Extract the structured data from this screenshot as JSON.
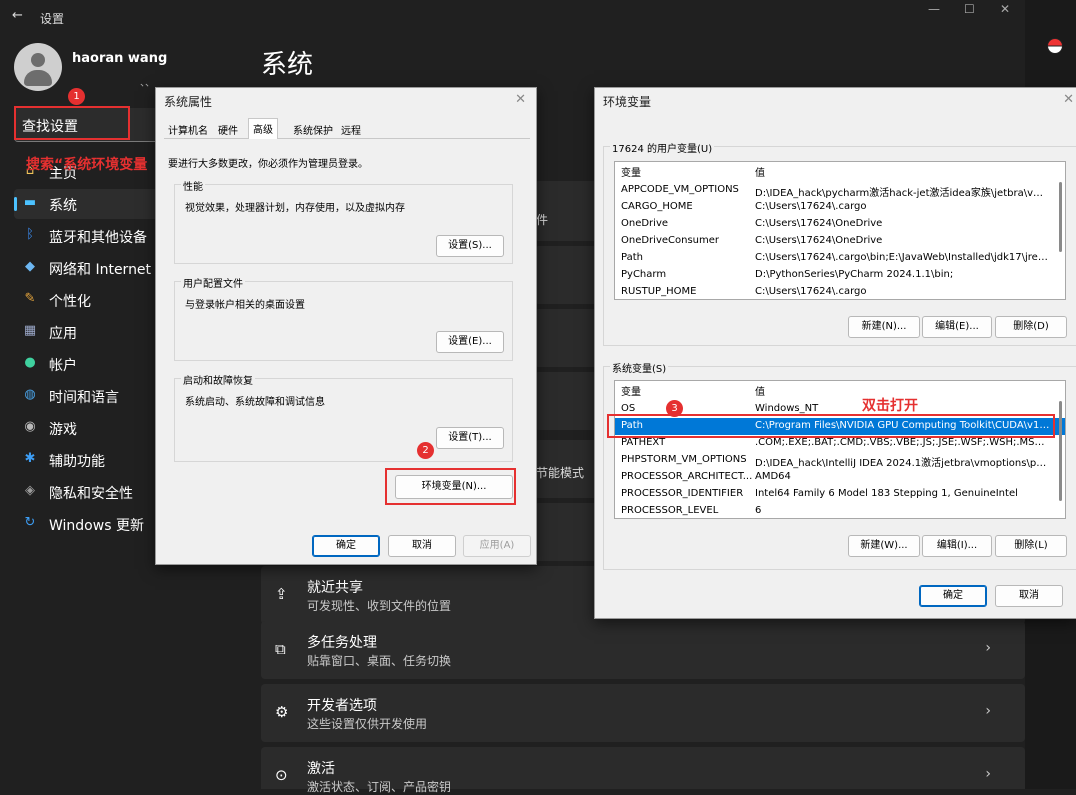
{
  "settings": {
    "title": "设置",
    "window_controls": [
      "—",
      "☐",
      "✕"
    ],
    "user": {
      "name": "haoran wang",
      "sub": "、、"
    },
    "search": {
      "value": "查找设置"
    },
    "nav": [
      {
        "label": "主页",
        "icon": "home-icon"
      },
      {
        "label": "系统",
        "icon": "system-icon"
      },
      {
        "label": "蓝牙和其他设备",
        "icon": "bluetooth-icon"
      },
      {
        "label": "网络和 Internet",
        "icon": "wifi-icon"
      },
      {
        "label": "个性化",
        "icon": "brush-icon"
      },
      {
        "label": "应用",
        "icon": "apps-icon"
      },
      {
        "label": "帐户",
        "icon": "account-icon"
      },
      {
        "label": "时间和语言",
        "icon": "globe-icon"
      },
      {
        "label": "游戏",
        "icon": "gamepad-icon"
      },
      {
        "label": "辅助功能",
        "icon": "accessibility-icon"
      },
      {
        "label": "隐私和安全性",
        "icon": "shield-icon"
      },
      {
        "label": "Windows 更新",
        "icon": "update-icon"
      }
    ],
    "page_title": "系统",
    "peek": {
      "text1": "件",
      "text2": "节能模式"
    },
    "cards": [
      {
        "title": "就近共享",
        "subtitle": "可发现性、收到文件的位置",
        "icon": "share-icon"
      },
      {
        "title": "多任务处理",
        "subtitle": "贴靠窗口、桌面、任务切换",
        "icon": "multitask-icon"
      },
      {
        "title": "开发者选项",
        "subtitle": "这些设置仅供开发使用",
        "icon": "developer-icon"
      },
      {
        "title": "激活",
        "subtitle": "激活状态、订阅、产品密钥",
        "icon": "activation-icon"
      }
    ],
    "chevron": "›"
  },
  "sysprops": {
    "title": "系统属性",
    "close": "✕",
    "tabs": [
      "计算机名",
      "硬件",
      "高级",
      "系统保护",
      "远程"
    ],
    "active_tab": "高级",
    "admin_note": "要进行大多数更改，你必须作为管理员登录。",
    "groups": [
      {
        "label": "性能",
        "desc": "视觉效果，处理器计划，内存使用，以及虚拟内存",
        "button": "设置(S)..."
      },
      {
        "label": "用户配置文件",
        "desc": "与登录帐户相关的桌面设置",
        "button": "设置(E)..."
      },
      {
        "label": "启动和故障恢复",
        "desc": "系统启动、系统故障和调试信息",
        "button": "设置(T)..."
      }
    ],
    "env_button": "环境变量(N)...",
    "ok": "确定",
    "cancel": "取消",
    "apply": "应用(A)"
  },
  "envvars": {
    "title": "环境变量",
    "close": "✕",
    "user_section": "17624 的用户变量(U)",
    "col_var": "变量",
    "col_val": "值",
    "user_vars": [
      {
        "name": "APPCODE_VM_OPTIONS",
        "value": "D:\\IDEA_hack\\pycharm激活hack-jet激活idea家族\\jetbra\\vmopt..."
      },
      {
        "name": "CARGO_HOME",
        "value": "C:\\Users\\17624\\.cargo"
      },
      {
        "name": "OneDrive",
        "value": "C:\\Users\\17624\\OneDrive"
      },
      {
        "name": "OneDriveConsumer",
        "value": "C:\\Users\\17624\\OneDrive"
      },
      {
        "name": "Path",
        "value": "C:\\Users\\17624\\.cargo\\bin;E:\\JavaWeb\\Installed\\jdk17\\jre\\bi..."
      },
      {
        "name": "PyCharm",
        "value": "D:\\PythonSeries\\PyCharm 2024.1.1\\bin;"
      },
      {
        "name": "RUSTUP_HOME",
        "value": "C:\\Users\\17624\\.cargo"
      }
    ],
    "user_buttons": [
      "新建(N)...",
      "编辑(E)...",
      "删除(D)"
    ],
    "sys_section": "系统变量(S)",
    "sys_vars": [
      {
        "name": "OS",
        "value": "Windows_NT"
      },
      {
        "name": "Path",
        "value": "C:\\Program Files\\NVIDIA GPU Computing Toolkit\\CUDA\\v12...."
      },
      {
        "name": "PATHEXT",
        "value": ".COM;.EXE;.BAT;.CMD;.VBS;.VBE;.JS;.JSE;.WSF;.WSH;.MSC;.PY;.P..."
      },
      {
        "name": "PHPSTORM_VM_OPTIONS",
        "value": "D:\\IDEA_hack\\IntelliJ IDEA 2024.1激活jetbra\\vmoptions\\phpst..."
      },
      {
        "name": "PROCESSOR_ARCHITECT...",
        "value": "AMD64"
      },
      {
        "name": "PROCESSOR_IDENTIFIER",
        "value": "Intel64 Family 6 Model 183 Stepping 1, GenuineIntel"
      },
      {
        "name": "PROCESSOR_LEVEL",
        "value": "6"
      }
    ],
    "sys_buttons": [
      "新建(W)...",
      "编辑(I)...",
      "删除(L)"
    ],
    "ok": "确定",
    "cancel": "取消"
  },
  "annotations": {
    "search_hint": "搜索“系统环境变量",
    "double_click_hint": "双击打开",
    "step1": "1",
    "step2": "2",
    "step3": "3",
    "color": "#e53030"
  }
}
